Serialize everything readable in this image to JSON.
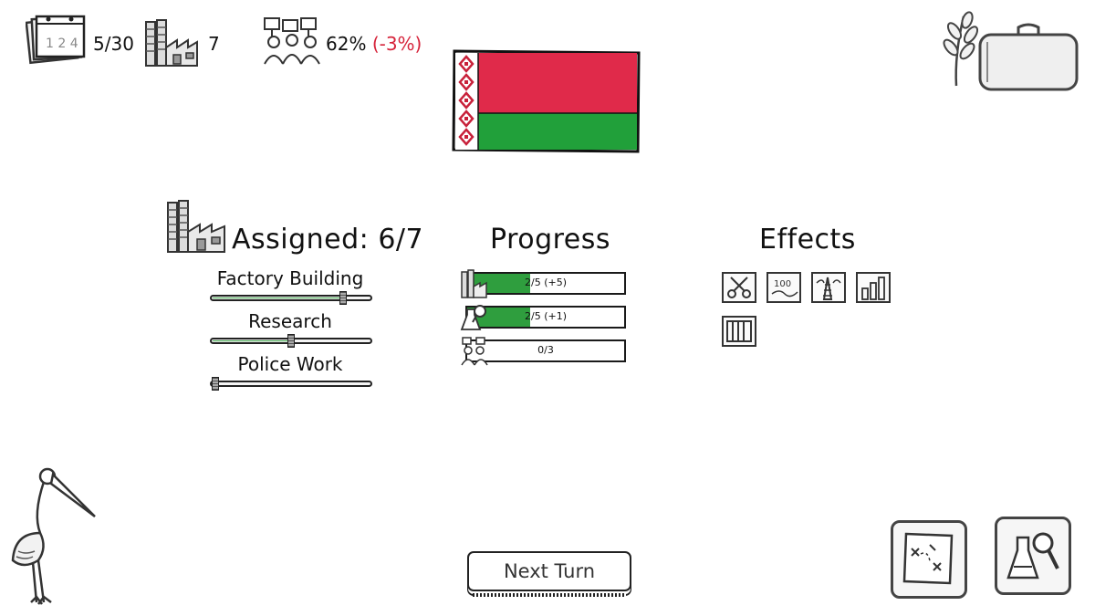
{
  "top_bar": {
    "turn_value": "5/30",
    "factories_value": "7",
    "approval_value": "62%",
    "approval_delta": "(-3%)"
  },
  "assigned": {
    "label": "Assigned: 6/7",
    "sliders": [
      {
        "label": "Factory Building",
        "level": 0.8
      },
      {
        "label": "Research",
        "level": 0.5
      },
      {
        "label": "Police Work",
        "level": 0.0
      }
    ]
  },
  "progress": {
    "label": "Progress",
    "bars": [
      {
        "icon": "factory-icon",
        "text": "2/5 (+5)",
        "fraction": 0.4
      },
      {
        "icon": "research-icon",
        "text": "2/5 (+1)",
        "fraction": 0.4
      },
      {
        "icon": "police-icon",
        "text": "0/3",
        "fraction": 0.0
      }
    ]
  },
  "effects": {
    "label": "Effects",
    "items": [
      "scissors-effect-icon",
      "document-effect-icon",
      "tower-effect-icon",
      "chart-effect-icon",
      "grid-effect-icon"
    ]
  },
  "next_turn": {
    "label": "Next Turn"
  },
  "colors": {
    "accent_green": "#2f9e3e",
    "flag_red": "#e02a4a",
    "flag_green": "#21a03a",
    "negative": "#d6243b"
  }
}
